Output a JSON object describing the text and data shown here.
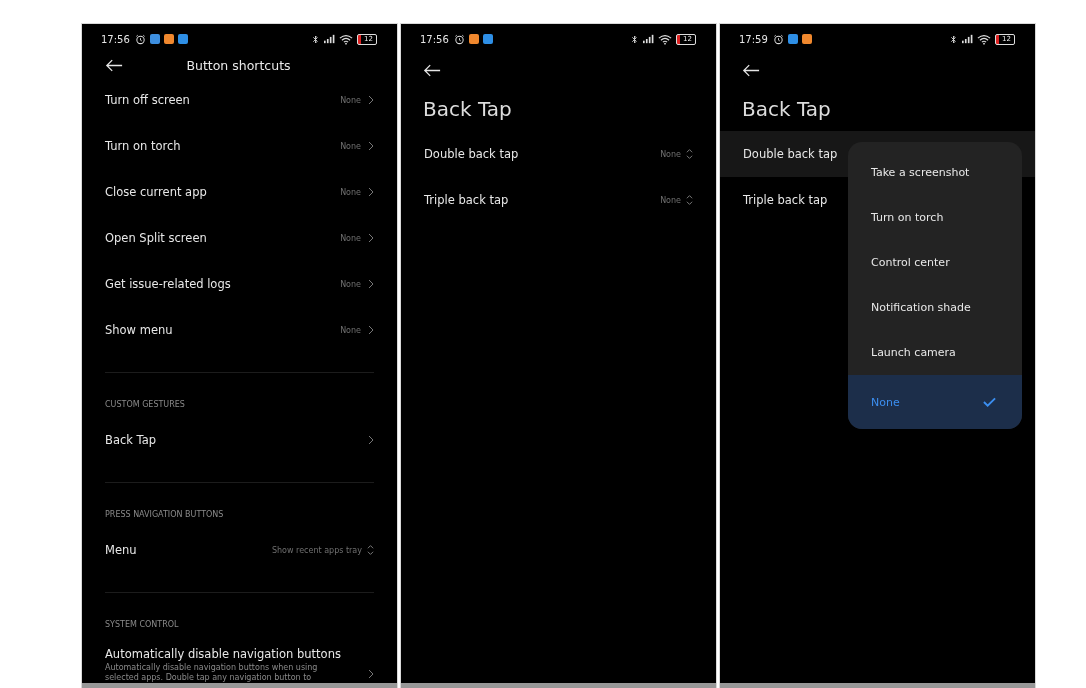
{
  "screens": [
    {
      "kind": "toolbar",
      "status_bar": {
        "time": "17:56",
        "app_icons": [
          {
            "color": "#3d8fe0"
          },
          {
            "color": "#f0882e"
          },
          {
            "color": "#2e8fe6"
          }
        ],
        "battery": "12"
      },
      "title": "Button shortcuts",
      "sections": [
        {
          "items": [
            {
              "kind": "chevron",
              "label": "Turn off screen",
              "value": "None",
              "highlighted": false
            },
            {
              "kind": "chevron",
              "label": "Turn on torch",
              "value": "None",
              "highlighted": false
            },
            {
              "kind": "chevron",
              "label": "Close current app",
              "value": "None",
              "highlighted": false
            },
            {
              "kind": "chevron",
              "label": "Open Split screen",
              "value": "None",
              "highlighted": false
            },
            {
              "kind": "chevron",
              "label": "Get issue-related logs",
              "value": "None",
              "highlighted": false
            },
            {
              "kind": "chevron",
              "label": "Show menu",
              "value": "None",
              "highlighted": false
            }
          ]
        },
        {
          "header": "CUSTOM GESTURES",
          "items": [
            {
              "kind": "chevron",
              "label": "Back Tap",
              "highlighted": false
            }
          ]
        },
        {
          "header": "PRESS NAVIGATION BUTTONS",
          "items": [
            {
              "kind": "spinner",
              "label": "Menu",
              "value": "Show recent apps tray",
              "highlighted": false
            }
          ]
        },
        {
          "header": "SYSTEM CONTROL",
          "items": [
            {
              "kind": "chevron",
              "label": "Automatically disable navigation buttons",
              "description": "Automatically disable navigation buttons when using selected apps. Double tap any navigation button to",
              "highlighted": false
            }
          ]
        }
      ]
    },
    {
      "kind": "large",
      "status_bar": {
        "time": "17:56",
        "app_icons": [
          {
            "color": "#f0882e"
          },
          {
            "color": "#2e8fe6"
          }
        ],
        "battery": "12"
      },
      "title": "Back Tap",
      "sections": [
        {
          "items": [
            {
              "kind": "spinner",
              "label": "Double back tap",
              "value": "None",
              "highlighted": false
            },
            {
              "kind": "spinner",
              "label": "Triple back tap",
              "value": "None",
              "highlighted": false
            }
          ]
        }
      ]
    },
    {
      "kind": "large",
      "status_bar": {
        "time": "17:59",
        "app_icons": [
          {
            "color": "#2e8fe6"
          },
          {
            "color": "#f0882e"
          }
        ],
        "battery": "12"
      },
      "title": "Back Tap",
      "sections": [
        {
          "items": [
            {
              "kind": "plain",
              "label": "Double back tap",
              "highlighted": true
            },
            {
              "kind": "plain",
              "label": "Triple back tap",
              "highlighted": false
            }
          ]
        }
      ],
      "menu": [
        {
          "label": "Take a screenshot",
          "selected": false
        },
        {
          "label": "Turn on torch",
          "selected": false
        },
        {
          "label": "Control center",
          "selected": false
        },
        {
          "label": "Notification shade",
          "selected": false
        },
        {
          "label": "Launch camera",
          "selected": false
        },
        {
          "label": "None",
          "selected": true
        }
      ]
    }
  ]
}
